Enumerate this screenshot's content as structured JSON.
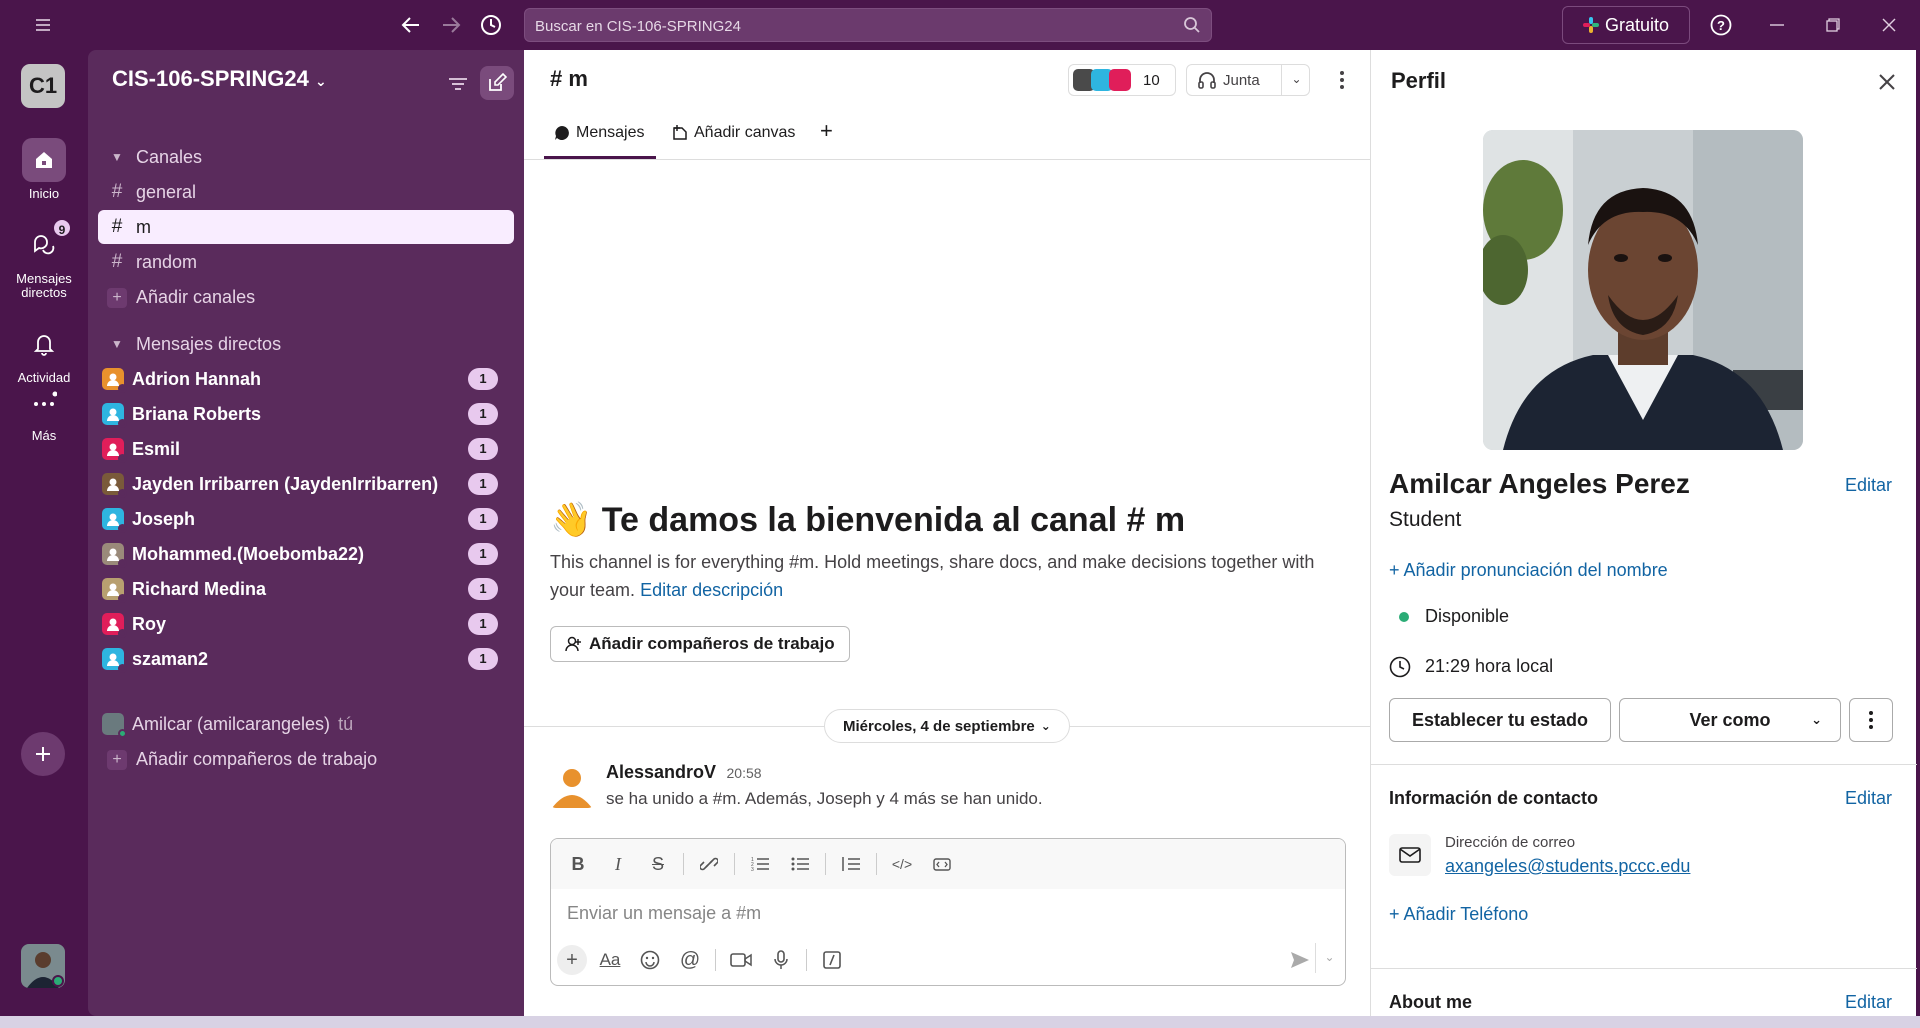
{
  "titlebar": {
    "search_placeholder": "Buscar en CIS-106-SPRING24",
    "plan_label": "Gratuito"
  },
  "rail": {
    "workspace_initials": "C1",
    "items": [
      {
        "label": "Inicio",
        "icon": "home-icon"
      },
      {
        "label": "Mensajes directos",
        "icon": "dm-icon",
        "badge": "9"
      },
      {
        "label": "Actividad",
        "icon": "bell-icon"
      },
      {
        "label": "Más",
        "icon": "more-icon"
      }
    ]
  },
  "sidebar": {
    "workspace_name": "CIS-106-SPRING24",
    "channels_header": "Canales",
    "channels": [
      "general",
      "m",
      "random"
    ],
    "add_channels": "Añadir canales",
    "dms_header": "Mensajes directos",
    "dms": [
      {
        "name": "Adrion Hannah",
        "badge": "1",
        "color": "#e8912d"
      },
      {
        "name": "Briana Roberts",
        "badge": "1",
        "color": "#2eb5e0"
      },
      {
        "name": "Esmil",
        "badge": "1",
        "color": "#e01e5a"
      },
      {
        "name": "Jayden Irribarren (JaydenIrribarren)",
        "badge": "1",
        "color": "#7a5a3a"
      },
      {
        "name": "Joseph",
        "badge": "1",
        "color": "#2eb5e0"
      },
      {
        "name": "Mohammed.(Moebomba22)",
        "badge": "1",
        "color": "#9a8a7a"
      },
      {
        "name": "Richard Medina",
        "badge": "1",
        "color": "#b8a070"
      },
      {
        "name": "Roy",
        "badge": "1",
        "color": "#e01e5a"
      },
      {
        "name": "szaman2",
        "badge": "1",
        "color": "#2eb5e0"
      }
    ],
    "self_name": "Amilcar (amilcarangeles)",
    "self_suffix": "tú",
    "add_coworkers": "Añadir compañeros de trabajo"
  },
  "channel": {
    "title": "# m",
    "member_count": "10",
    "huddle_label": "Junta",
    "tabs": [
      "Mensajes",
      "Añadir canvas"
    ],
    "welcome_emoji": "👋",
    "welcome_title": "Te damos la bienvenida al canal # m",
    "welcome_desc": "This channel is for everything #m. Hold meetings, share docs, and make decisions together with your team.",
    "edit_desc": "Editar descripción",
    "add_coworkers_btn": "Añadir compañeros de trabajo",
    "date_divider": "Miércoles, 4 de septiembre",
    "message": {
      "author": "AlessandroV",
      "time": "20:58",
      "text": "se ha unido a #m. Además, Joseph y 4 más se han unido."
    },
    "composer_placeholder": "Enviar un mensaje a #m"
  },
  "profile": {
    "title": "Perfil",
    "name": "Amilcar Angeles Perez",
    "edit": "Editar",
    "role": "Student",
    "add_pronunciation": "Añadir pronunciación del nombre",
    "status": "Disponible",
    "local_time": "21:29 hora local",
    "set_status_btn": "Establecer tu estado",
    "view_as_btn": "Ver como",
    "contact_header": "Información de contacto",
    "email_label": "Dirección de correo",
    "email": "axangeles@students.pccc.edu",
    "add_phone": "Añadir Teléfono",
    "about_header": "About me",
    "accent": "#1264a3",
    "presence_color": "#2bac76"
  }
}
